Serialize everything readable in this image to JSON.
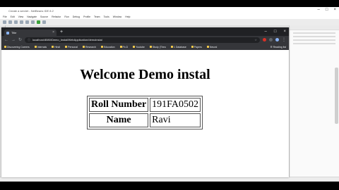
{
  "ide": {
    "title": "Create a servlet - NetBeans IDE 8.2",
    "menu": [
      "File",
      "Edit",
      "View",
      "Navigate",
      "Source",
      "Refactor",
      "Run",
      "Debug",
      "Profile",
      "Team",
      "Tools",
      "Window",
      "Help"
    ]
  },
  "browser": {
    "tab_title": "Title",
    "url": "localhost:8080/Demo_Instal/WebApplication/demoinstal",
    "bookmarks": [
      "Discovering Careers",
      "Internals",
      "Hindi",
      "Personal",
      "Research",
      "Education",
      "Fb.D",
      "Youtube",
      "Study (Theo",
      "1 Database",
      "Papers",
      "Neural"
    ],
    "reading_list": "Reading list"
  },
  "page": {
    "heading": "Welcome Demo instal",
    "rows": [
      {
        "label": "Roll Number",
        "value": "191FA0502"
      },
      {
        "label": "Name",
        "value": "Ravi"
      }
    ]
  },
  "colors": {
    "tabstrip": "#202124",
    "toolbar": "#35363a",
    "page_bg": "#ffffff",
    "heading": "#000000"
  }
}
